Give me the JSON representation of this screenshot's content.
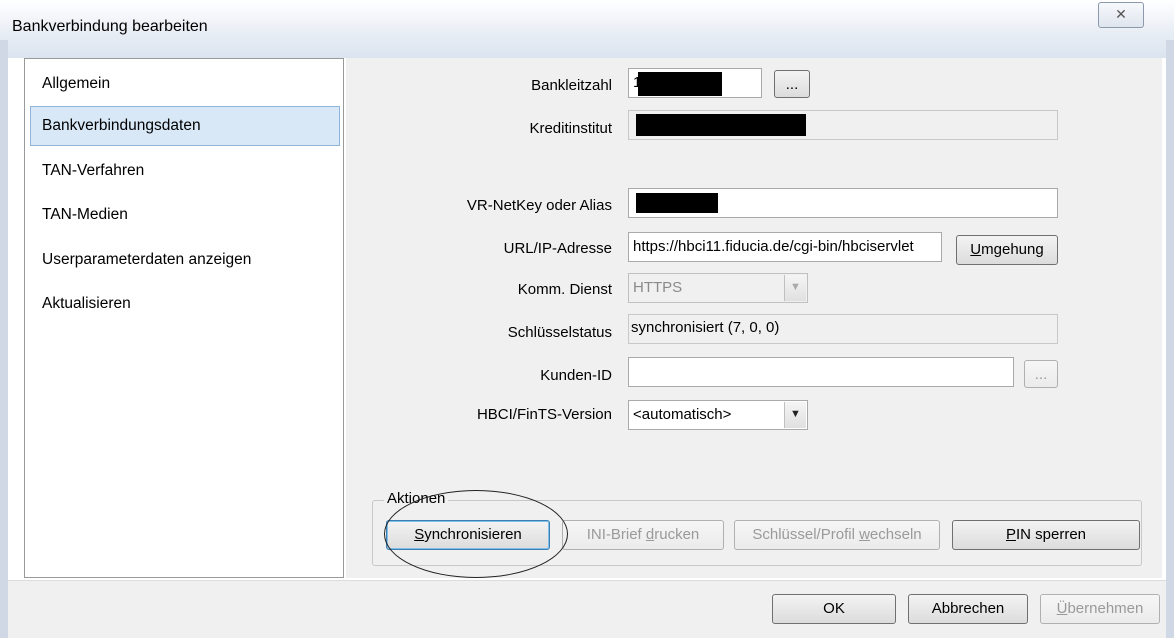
{
  "window": {
    "title": "Bankverbindung bearbeiten",
    "close_glyph": "✕"
  },
  "sidebar": {
    "items": [
      {
        "label": "Allgemein"
      },
      {
        "label": "Bankverbindungsdaten",
        "selected": true
      },
      {
        "label": "TAN-Verfahren"
      },
      {
        "label": "TAN-Medien"
      },
      {
        "label": "Userparameterdaten anzeigen"
      },
      {
        "label": "Aktualisieren"
      }
    ]
  },
  "form": {
    "bankleitzahl": {
      "label": "Bankleitzahl",
      "value": "1",
      "browse_label": "..."
    },
    "kreditinstitut": {
      "label": "Kreditinstitut",
      "value": ""
    },
    "netkey": {
      "label": "VR-NetKey oder Alias",
      "value": ""
    },
    "url": {
      "label": "URL/IP-Adresse",
      "value": "https://hbci11.fiducia.de/cgi-bin/hbciservlet",
      "button_label": "Umgehung"
    },
    "komm_dienst": {
      "label": "Komm. Dienst",
      "value": "HTTPS"
    },
    "schluesselstatus": {
      "label": "Schlüsselstatus",
      "value": "synchronisiert (7, 0, 0)"
    },
    "kunden_id": {
      "label": "Kunden-ID",
      "value": "",
      "browse_label": "..."
    },
    "hbci_version": {
      "label": "HBCI/FinTS-Version",
      "value": "<automatisch>"
    }
  },
  "actions": {
    "legend": "Aktionen",
    "synchronisieren": "Synchronisieren",
    "ini_brief": "INI-Brief drucken",
    "schluessel_wechseln": "Schlüssel/Profil wechseln",
    "pin_sperren": "PIN sperren"
  },
  "footer": {
    "ok": "OK",
    "abbrechen": "Abbrechen",
    "uebernehmen": "Übernehmen"
  }
}
